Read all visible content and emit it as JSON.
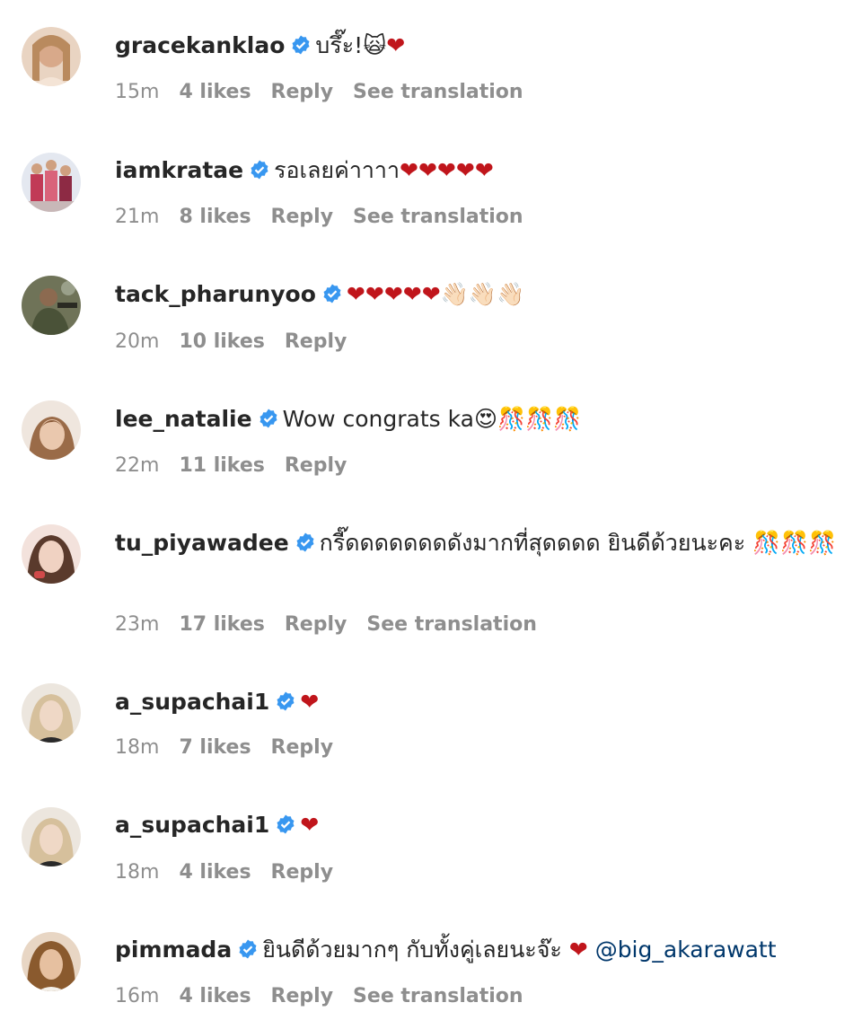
{
  "comments": [
    {
      "username": "gracekanklao",
      "text": "บรึ๊ะ!🙀❤",
      "time": "15m",
      "likes": "4 likes",
      "reply": "Reply",
      "translation": "See translation",
      "avatar_color": "#d8a98a"
    },
    {
      "username": "iamkratae",
      "text": "รอเลยค่าาาา❤❤❤❤❤",
      "time": "21m",
      "likes": "8 likes",
      "reply": "Reply",
      "translation": "See translation",
      "avatar_color": "#b03050"
    },
    {
      "username": "tack_pharunyoo",
      "text": "❤❤❤❤❤👋🏻👋🏻👋🏻",
      "time": "20m",
      "likes": "10 likes",
      "reply": "Reply",
      "translation": "",
      "avatar_color": "#5a6048"
    },
    {
      "username": "lee_natalie",
      "text": "Wow congrats ka😍🎊🎊🎊",
      "time": "22m",
      "likes": "11 likes",
      "reply": "Reply",
      "translation": "",
      "avatar_color": "#caa48c"
    },
    {
      "username": "tu_piyawadee",
      "text": "กรี๊ดดดดดดดดังมากที่สุดดดด ยินดีด้วยนะคะ 🎊🎊🎊",
      "time": "23m",
      "likes": "17 likes",
      "reply": "Reply",
      "translation": "See translation",
      "avatar_color": "#e8c8c0"
    },
    {
      "username": "a_supachai1",
      "text": "❤",
      "time": "18m",
      "likes": "7 likes",
      "reply": "Reply",
      "translation": "",
      "avatar_color": "#c8b49c"
    },
    {
      "username": "a_supachai1",
      "text": "❤",
      "time": "18m",
      "likes": "4 likes",
      "reply": "Reply",
      "translation": "",
      "avatar_color": "#c8b49c"
    },
    {
      "username": "pimmada",
      "text": "ยินดีด้วยมากๆ กับทั้งคู่เลยนะจ๊ะ ❤",
      "mention": "@big_akarawatt",
      "time": "16m",
      "likes": "4 likes",
      "reply": "Reply",
      "translation": "See translation",
      "avatar_color": "#a06a3c"
    }
  ],
  "colors": {
    "verified_badge": "#3897f0",
    "meta_text": "#8e8e8e",
    "mention": "#00376b",
    "heart": "#c0151b"
  },
  "icons": {
    "verified": "verified-badge-icon"
  }
}
